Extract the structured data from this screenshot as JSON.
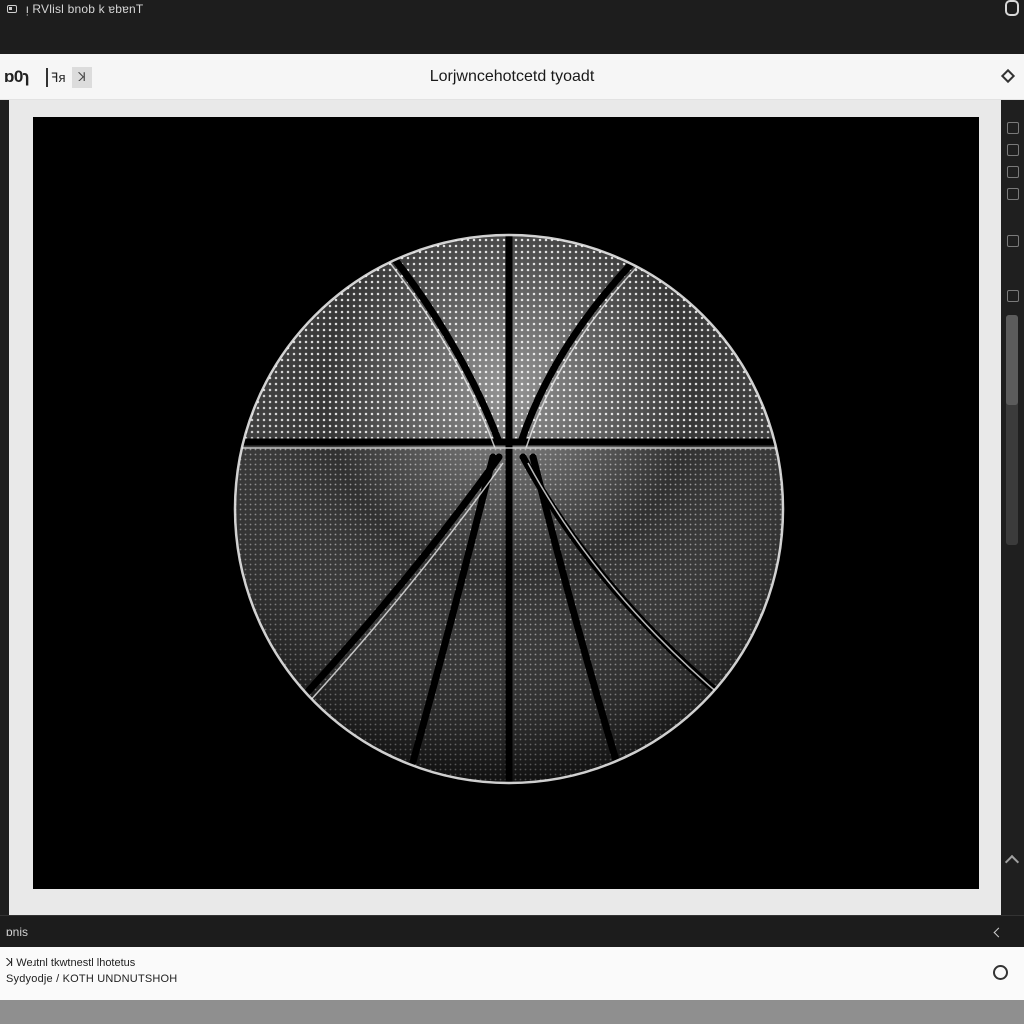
{
  "system_bar": {
    "title": "ᴉ RVlisl bnob   k ɐbɐnT",
    "app_icon": "window-icon",
    "button_icon": "square-button-icon"
  },
  "toolbar": {
    "zoom_label": "ɒ0ɿ",
    "tool_a_label": "ꟻᴙ",
    "tool_b_label": "ꓘ",
    "window_title": "Lorjwncehotcetd tyoadt",
    "menu_icon": "diamond-menu-icon"
  },
  "image": {
    "subject": "basketball",
    "colors": {
      "background": "#000000",
      "ball_light": "#ffffff",
      "ball_dark": "#1a1a1a"
    }
  },
  "status_bar": {
    "text": "ɒnis",
    "collapse_icon": "chevron-left-icon"
  },
  "info_panel": {
    "line1": "ꓘ Weɹtnl tkwtnestl lhotetus",
    "line2": "Sydyodje / KOTH UNDNUTSHOH",
    "info_icon": "circle-icon"
  },
  "colors": {
    "chrome_dark": "#1d1d1d",
    "toolbar_light": "#f6f6f6",
    "frame": "#e9e9e9",
    "bottom_bar": "#8f8f8f"
  }
}
